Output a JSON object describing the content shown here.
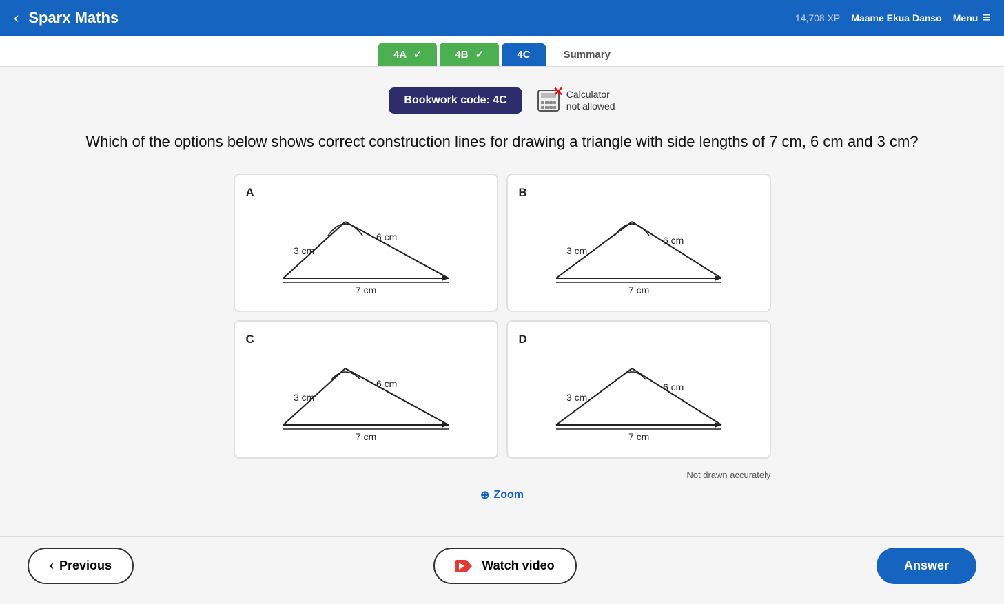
{
  "header": {
    "back_label": "‹",
    "title": "Sparx Maths",
    "xp": "14,708 XP",
    "username": "Maame Ekua Danso",
    "menu_label": "Menu"
  },
  "tabs": [
    {
      "id": "4A",
      "label": "4A",
      "state": "completed"
    },
    {
      "id": "4B",
      "label": "4B",
      "state": "completed"
    },
    {
      "id": "4C",
      "label": "4C",
      "state": "active"
    },
    {
      "id": "summary",
      "label": "Summary",
      "state": "summary"
    }
  ],
  "bookwork": {
    "code_label": "Bookwork code: 4C",
    "calculator_line1": "Calculator",
    "calculator_line2": "not allowed"
  },
  "question": {
    "text": "Which of the options below shows correct construction lines for drawing a triangle with side lengths of 7 cm, 6 cm and 3 cm?"
  },
  "options": [
    {
      "id": "A",
      "label": "A",
      "has_construction": true,
      "double_line_top": true
    },
    {
      "id": "B",
      "label": "B",
      "has_construction": true,
      "double_line_top": true
    },
    {
      "id": "C",
      "label": "C",
      "has_construction": false,
      "double_line_top": false
    },
    {
      "id": "D",
      "label": "D",
      "has_construction": false,
      "double_line_top": false
    }
  ],
  "not_drawn": "Not drawn accurately",
  "zoom": {
    "icon": "⊕",
    "label": "Zoom"
  },
  "buttons": {
    "previous": "‹ Previous",
    "watch_video": "Watch video",
    "answer": "Answer"
  }
}
